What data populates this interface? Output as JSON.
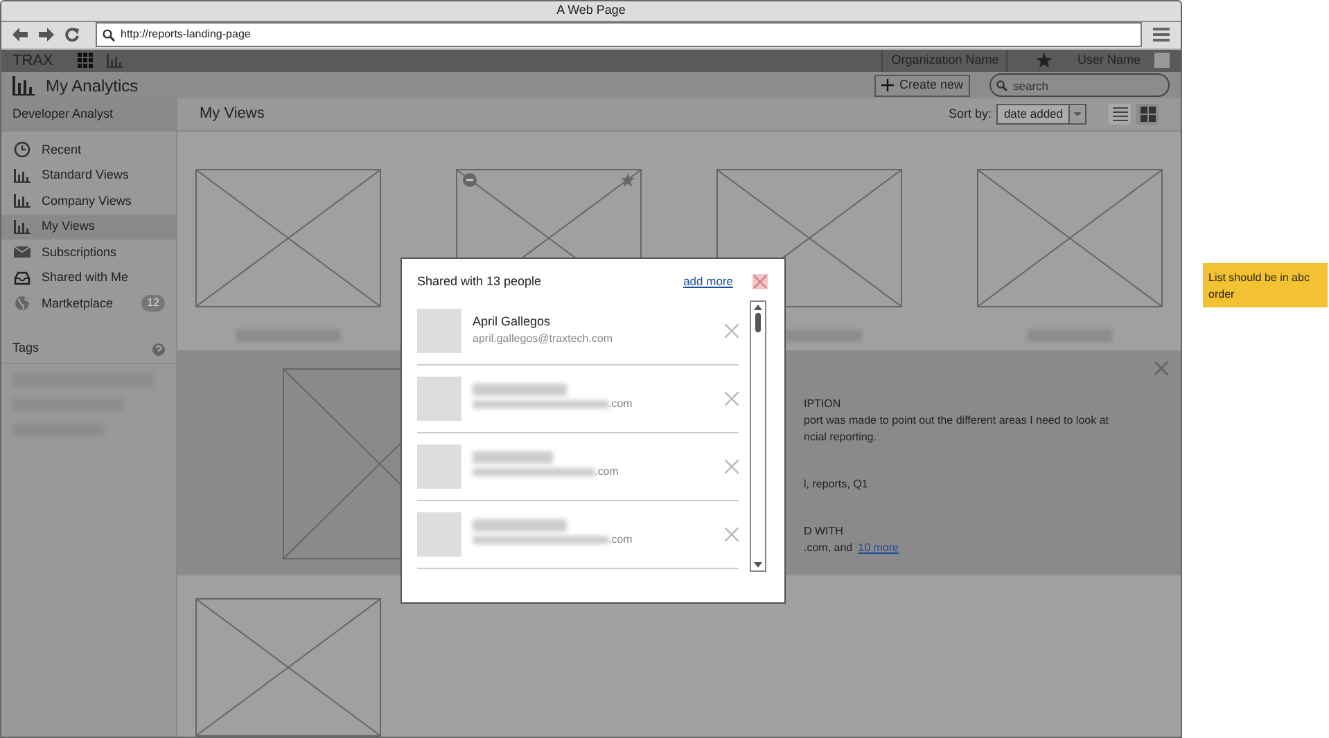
{
  "browser": {
    "title": "A Web Page",
    "url": "http://reports-landing-page"
  },
  "app_bar": {
    "brand": "TRAX",
    "organization": "Organization Name",
    "user": "User Name"
  },
  "header": {
    "title": "My Analytics",
    "create_button": "Create new",
    "search": {
      "placeholder": "search"
    }
  },
  "sidebar": {
    "role": "Developer Analyst",
    "items": [
      {
        "label": "Recent",
        "kind": "clock",
        "selected": false
      },
      {
        "label": "Standard Views",
        "kind": "chart",
        "selected": false
      },
      {
        "label": "Company Views",
        "kind": "chart",
        "selected": false
      },
      {
        "label": "My Views",
        "kind": "chart",
        "selected": true
      },
      {
        "label": "Subscriptions",
        "kind": "mail",
        "selected": false
      },
      {
        "label": "Shared with Me",
        "kind": "inbox",
        "selected": false
      },
      {
        "label": "Martketplace",
        "kind": "globe",
        "selected": false,
        "badge": "12"
      }
    ],
    "tags_title": "Tags"
  },
  "content": {
    "title": "My Views",
    "sort_label": "Sort by:",
    "sort_value": "date added",
    "view_modes": [
      {
        "kind": "list",
        "selected": false
      },
      {
        "kind": "grid",
        "selected": true
      }
    ]
  },
  "details": {
    "heading": "IPTION",
    "description": [
      "port was made to point out the different areas I need to look at",
      "ncial reporting."
    ],
    "tags": "l, reports, Q1",
    "shared_heading": "D WITH",
    "shared_suffix": ".com, and",
    "more_link": "10 more"
  },
  "modal": {
    "title": "Shared with 13 people",
    "add_link": "add more",
    "people": [
      {
        "name": "April Gallegos",
        "email": "april.gallegos@traxtech.com"
      },
      {
        "email": ".com"
      },
      {
        "email": ".com"
      },
      {
        "email": ".com"
      }
    ]
  },
  "note": "List should be in abc order"
}
